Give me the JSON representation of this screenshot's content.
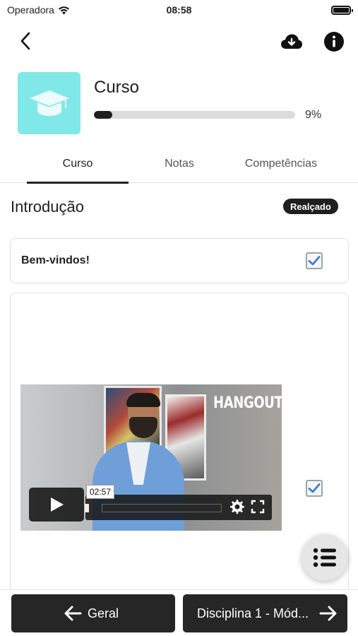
{
  "status_bar": {
    "carrier": "Operadora",
    "time": "08:58"
  },
  "header": {
    "back_icon": "chevron-left-icon",
    "download_icon": "cloud-download-icon",
    "info_icon": "info-icon"
  },
  "course": {
    "title": "Curso",
    "progress_text": "9%",
    "progress_fraction": 0.09,
    "thumbnail_icon": "graduation-cap-icon",
    "thumbnail_color": "#80e8e8"
  },
  "tabs": [
    {
      "label": "Curso",
      "active": true
    },
    {
      "label": "Notas",
      "active": false
    },
    {
      "label": "Competências",
      "active": false
    }
  ],
  "section": {
    "title": "Introdução",
    "badge": "Realçado"
  },
  "activities": [
    {
      "label": "Bem-vindos!",
      "completed": true
    },
    {
      "type": "video",
      "video_overlay_text": "HANGOUT",
      "video_time": "02:57",
      "completed": true
    }
  ],
  "bottom_nav": {
    "prev_label": "Geral",
    "next_label": "Disciplina 1 - Mód..."
  }
}
